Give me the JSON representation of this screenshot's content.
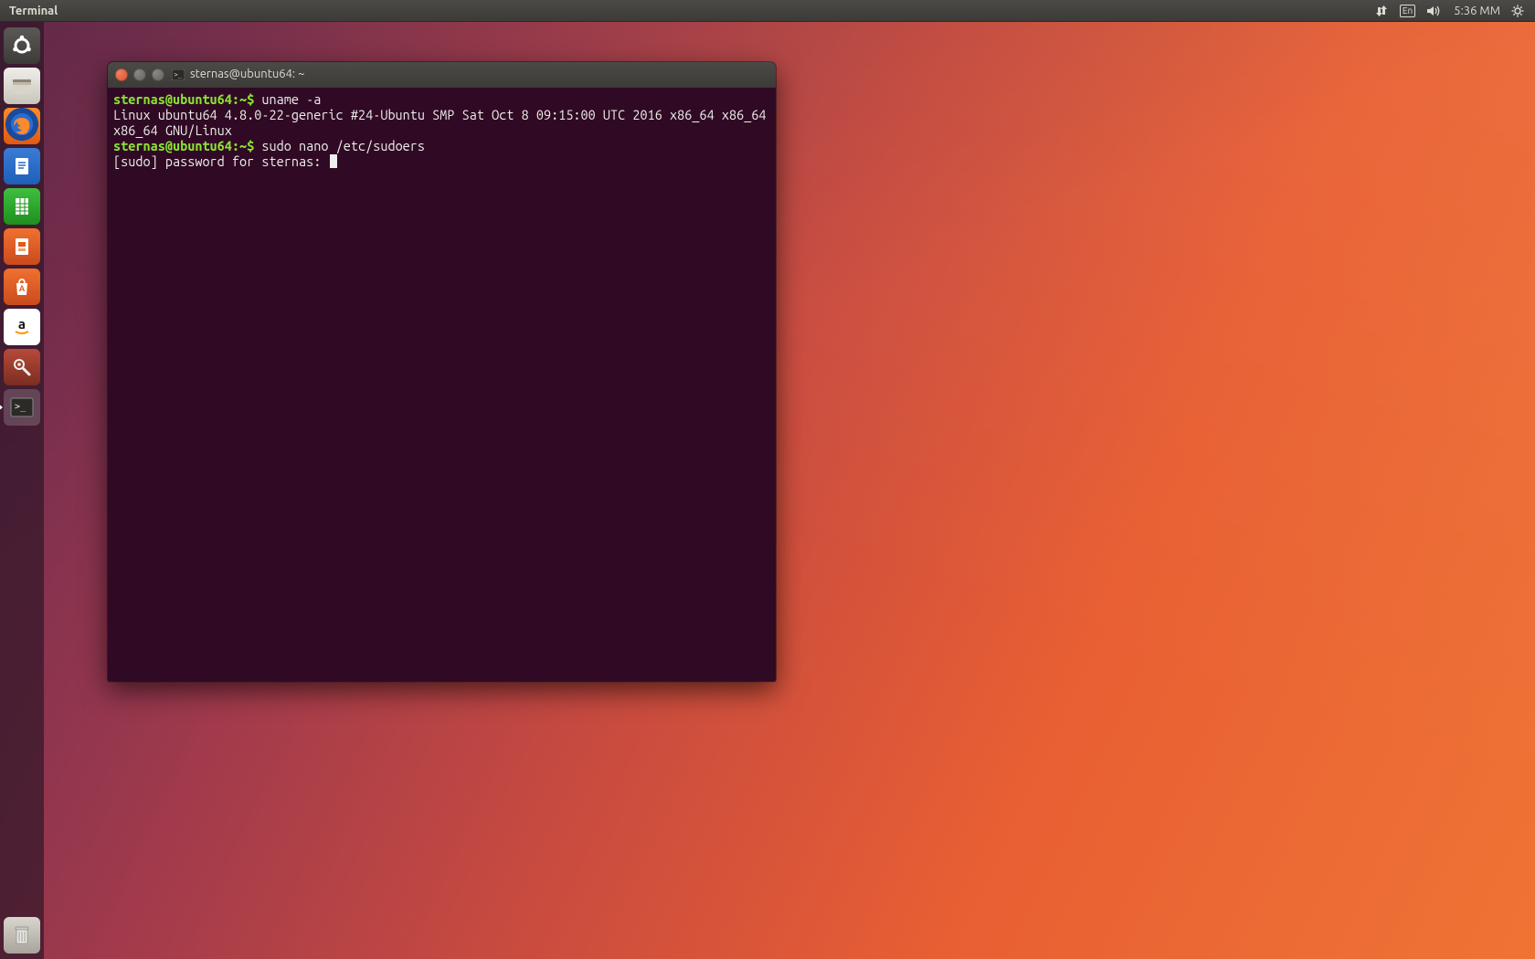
{
  "top_panel": {
    "app_title": "Terminal",
    "language": "En",
    "clock": "5:36 MM"
  },
  "launcher": {
    "items": [
      {
        "name": "dash",
        "label": "Dash"
      },
      {
        "name": "files",
        "label": "Files"
      },
      {
        "name": "firefox",
        "label": "Firefox"
      },
      {
        "name": "writer",
        "label": "LibreOffice Writer"
      },
      {
        "name": "calc",
        "label": "LibreOffice Calc"
      },
      {
        "name": "impress",
        "label": "LibreOffice Impress"
      },
      {
        "name": "software",
        "label": "Ubuntu Software"
      },
      {
        "name": "amazon",
        "label": "Amazon"
      },
      {
        "name": "settings",
        "label": "System Settings"
      },
      {
        "name": "terminal",
        "label": "Terminal"
      }
    ],
    "trash_label": "Trash"
  },
  "terminal": {
    "title": "sternas@ubuntu64: ~",
    "prompt": "sternas@ubuntu64:~$",
    "cmd1": "uname -a",
    "output1": "Linux ubuntu64 4.8.0-22-generic #24-Ubuntu SMP Sat Oct 8 09:15:00 UTC 2016 x86_64 x86_64 x86_64 GNU/Linux",
    "cmd2": "sudo nano /etc/sudoers",
    "sudo_prompt": "[sudo] password for sternas: "
  }
}
